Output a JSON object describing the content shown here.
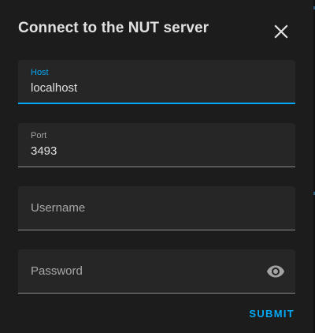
{
  "dialog": {
    "title": "Connect to the NUT server",
    "close_icon": "close-icon"
  },
  "fields": {
    "host": {
      "label": "Host",
      "value": "localhost"
    },
    "port": {
      "label": "Port",
      "value": "3493"
    },
    "username": {
      "placeholder": "Username"
    },
    "password": {
      "placeholder": "Password",
      "toggle_icon": "eye-icon"
    }
  },
  "actions": {
    "submit_label": "SUBMIT"
  },
  "colors": {
    "accent": "#03a9f4",
    "dialog_bg": "#1c1c1c",
    "field_bg": "#262626",
    "text_primary": "#e1e1e1",
    "text_secondary": "#a8a8a8"
  }
}
